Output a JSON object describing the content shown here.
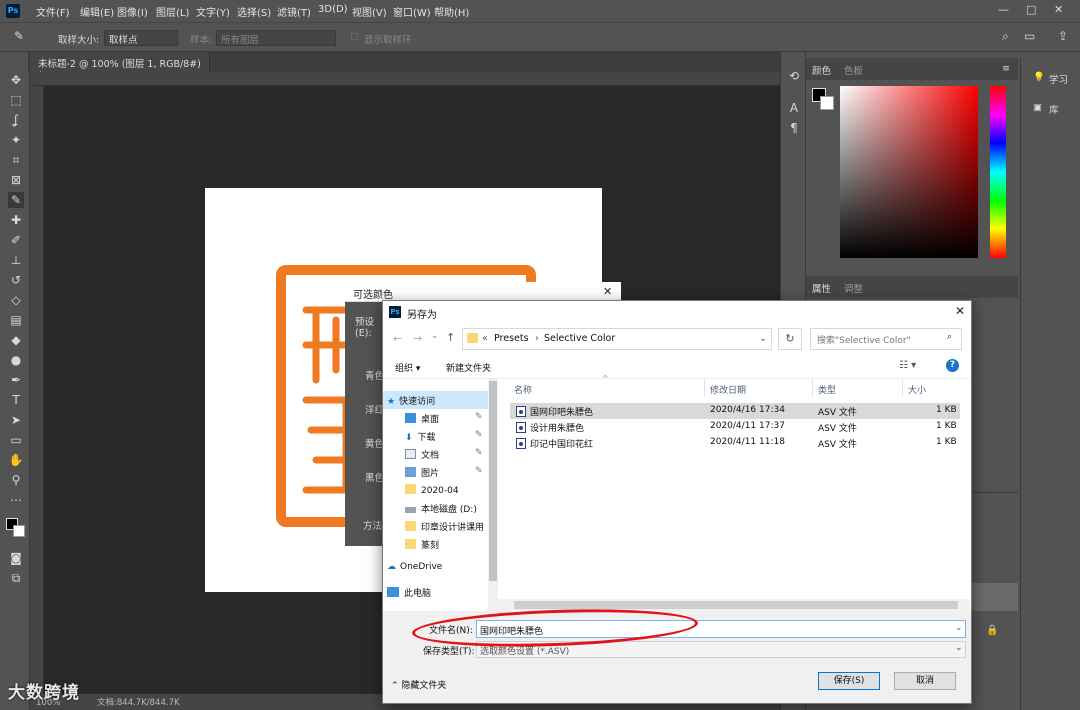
{
  "menubar": {
    "items": [
      "文件(F)",
      "编辑(E)",
      "图像(I)",
      "图层(L)",
      "文字(Y)",
      "选择(S)",
      "滤镜(T)",
      "3D(D)",
      "视图(V)",
      "窗口(W)",
      "帮助(H)"
    ],
    "app_icon": "Ps"
  },
  "optionsbar": {
    "sample_size_label": "取样大小:",
    "sample_size_value": "取样点",
    "sample_label": "样本:",
    "sample_value": "所有图层",
    "show_ring_label": "显示取样环"
  },
  "document": {
    "tab_label": "未标题-2 @ 100% (图层 1, RGB/8#) *",
    "zoom": "100%",
    "doc_info": "文档:844.7K/844.7K",
    "seal_color": "#f07a20"
  },
  "panels": {
    "color_tab": "颜色",
    "swatches_tab": "色板",
    "properties_tab": "属性",
    "adjustments_tab": "调整",
    "learn": "学习",
    "library": "库"
  },
  "selective_color_dialog": {
    "title": "可选颜色",
    "preset_label": "预设(E):",
    "rows": [
      "青色",
      "洋红",
      "黄色",
      "黑色"
    ],
    "method_label": "方法"
  },
  "save_dialog": {
    "title": "另存为",
    "breadcrumb": [
      "Presets",
      "Selective Color"
    ],
    "search_placeholder": "搜索\"Selective Color\"",
    "organize_label": "组织 ▾",
    "new_folder_label": "新建文件夹",
    "help_icon": "?",
    "nav_items": [
      {
        "label": "快速访问",
        "icon": "star-icon"
      },
      {
        "label": "桌面",
        "icon": "desktop-icon"
      },
      {
        "label": "下载",
        "icon": "download-icon"
      },
      {
        "label": "文档",
        "icon": "document-icon"
      },
      {
        "label": "图片",
        "icon": "picture-icon"
      },
      {
        "label": "2020-04",
        "icon": "folder-icon"
      },
      {
        "label": "本地磁盘 (D:)",
        "icon": "drive-icon"
      },
      {
        "label": "印章设计讲课用",
        "icon": "folder-icon"
      },
      {
        "label": "篆刻",
        "icon": "folder-icon"
      },
      {
        "label": "OneDrive",
        "icon": "cloud-icon"
      },
      {
        "label": "此电脑",
        "icon": "computer-icon"
      }
    ],
    "columns": {
      "name": "名称",
      "date": "修改日期",
      "type": "类型",
      "size": "大小"
    },
    "files": [
      {
        "name": "国网印吧朱膘色",
        "date": "2020/4/16 17:34",
        "type": "ASV 文件",
        "size": "1 KB"
      },
      {
        "name": "设计用朱膘色",
        "date": "2020/4/11 17:37",
        "type": "ASV 文件",
        "size": "1 KB"
      },
      {
        "name": "印记中国印花红",
        "date": "2020/4/11 11:18",
        "type": "ASV 文件",
        "size": "1 KB"
      }
    ],
    "filename_label": "文件名(N):",
    "filename_value": "国网印吧朱膘色",
    "filetype_label": "保存类型(T):",
    "filetype_value": "选取颜色设置 (*.ASV)",
    "hide_folders_label": "隐藏文件夹",
    "save_button": "保存(S)",
    "cancel_button": "取消"
  },
  "watermark": "大数跨境",
  "colors": {
    "ps_bg": "#535353",
    "canvas_bg": "#282828",
    "highlight_oval": "#e0141b",
    "accent_blue": "#0078d7"
  }
}
